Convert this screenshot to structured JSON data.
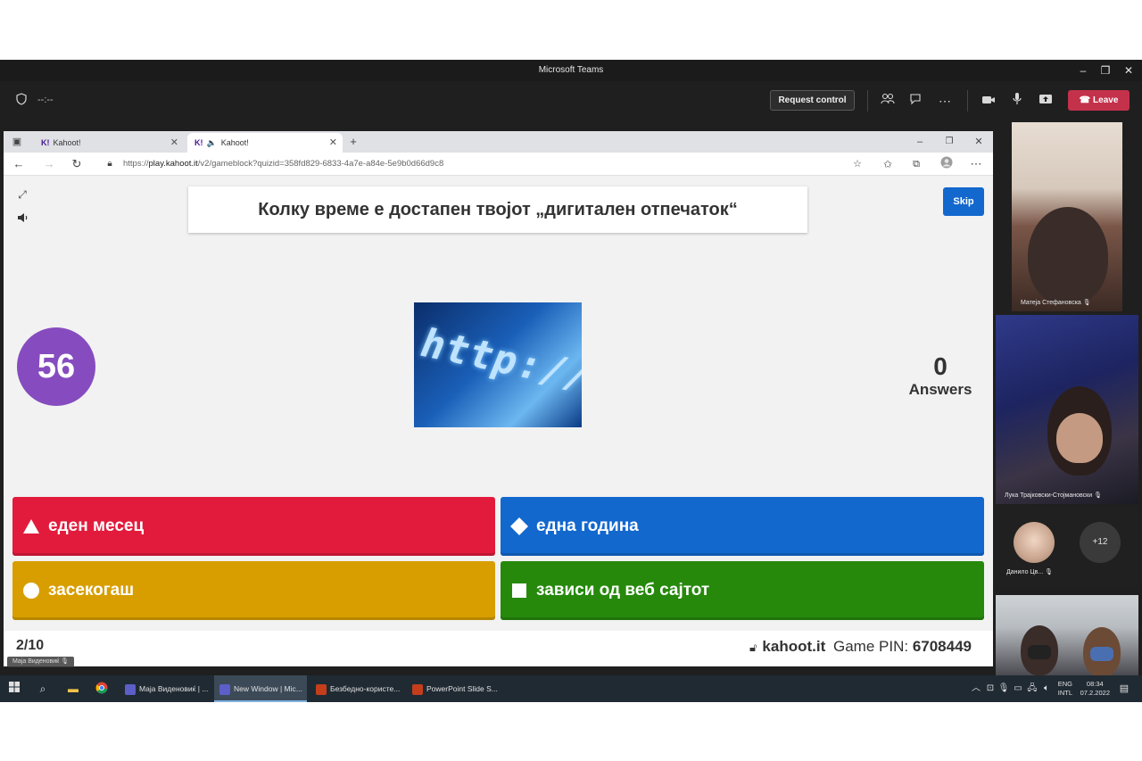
{
  "teams": {
    "window_title": "Microsoft Teams",
    "timer": "--:--",
    "request_control": "Request control",
    "leave": "Leave"
  },
  "browser": {
    "tabs": [
      {
        "label": "Kahoot!"
      },
      {
        "label": "Kahoot!"
      }
    ],
    "url_prefix": "https://",
    "url_host": "play.kahoot.it",
    "url_path": "/v2/gameblock?quizid=358fd829-6833-4a7e-a84e-5e9b0d66d9c8"
  },
  "kahoot": {
    "question": "Колку време е достапен твојот „дигитален отпечаток“",
    "skip": "Skip",
    "timer": "56",
    "answers_count": "0",
    "answers_label": "Answers",
    "image_text": "http://www",
    "options": [
      {
        "label": "еден месец",
        "shape": "triangle",
        "color": "#e21b3c"
      },
      {
        "label": "една година",
        "shape": "diamond",
        "color": "#1368ce"
      },
      {
        "label": "засекогаш",
        "shape": "circle",
        "color": "#d89e00"
      },
      {
        "label": "зависи од веб сајтот",
        "shape": "square",
        "color": "#26890c"
      }
    ],
    "progress": "2/10",
    "brand": "kahoot.it",
    "pin_label": "Game PIN:",
    "pin": "6708449"
  },
  "presenter_name": "Маја Виденовиќ",
  "participants": {
    "p1": "Матеја Стефановска",
    "p2": "Лука Трајковски-Стојмановски",
    "p3": "Данило Цв...",
    "more": "+12"
  },
  "taskbar": {
    "apps": [
      {
        "label": "Маја Виденовиќ | ..."
      },
      {
        "label": "New Window | Mic..."
      },
      {
        "label": "Безбедно-користе..."
      },
      {
        "label": "PowerPoint Slide S..."
      }
    ],
    "lang_top": "ENG",
    "lang_bottom": "INTL",
    "time": "08:34",
    "date": "07.2.2022"
  }
}
